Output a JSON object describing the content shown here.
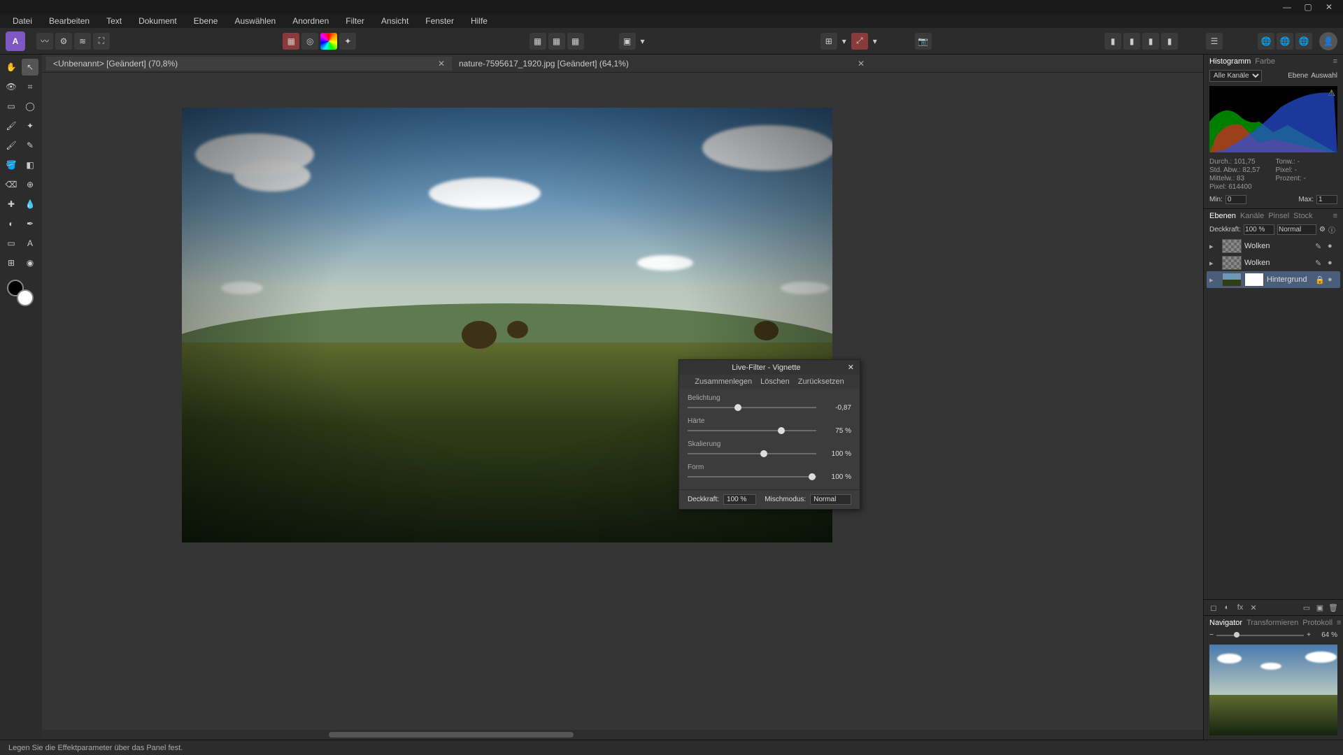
{
  "menu": [
    "Datei",
    "Bearbeiten",
    "Text",
    "Dokument",
    "Ebene",
    "Auswählen",
    "Anordnen",
    "Filter",
    "Ansicht",
    "Fenster",
    "Hilfe"
  ],
  "tabs": [
    {
      "title": "<Unbenannt> [Geändert] (70,8%)",
      "active": true
    },
    {
      "title": "nature-7595617_1920.jpg [Geändert] (64,1%)",
      "active": false
    }
  ],
  "dialog": {
    "title": "Live-Filter - Vignette",
    "actions": [
      "Zusammenlegen",
      "Löschen",
      "Zurücksetzen"
    ],
    "sliders": [
      {
        "label": "Belichtung",
        "value": "-0,87",
        "pos": 39
      },
      {
        "label": "Härte",
        "value": "75 %",
        "pos": 73
      },
      {
        "label": "Skalierung",
        "value": "100 %",
        "pos": 59
      },
      {
        "label": "Form",
        "value": "100 %",
        "pos": 97
      }
    ],
    "opacity_label": "Deckkraft:",
    "opacity_value": "100 %",
    "blend_label": "Mischmodus:",
    "blend_value": "Normal"
  },
  "rightpanel": {
    "top_tabs": [
      "Histogramm",
      "Farbe"
    ],
    "channel_label": "Alle Kanäle",
    "channel_r1": "Ebene",
    "channel_r2": "Auswahl",
    "stats": {
      "durch": "Durch.: 101,75",
      "tonw": "Tonw.: -",
      "std": "Std. Abw.: 82,57",
      "pixelr": "Pixel: -",
      "mittel": "Mittelw.: 83",
      "prozent": "Prozent: -",
      "pixel": "Pixel: 614400"
    },
    "min_label": "Min:",
    "min_val": "0",
    "max_label": "Max:",
    "max_val": "1",
    "layer_tabs": [
      "Ebenen",
      "Kanäle",
      "Pinsel",
      "Stock"
    ],
    "layer_opacity_label": "Deckkraft:",
    "layer_opacity": "100 %",
    "layer_blend": "Normal",
    "layers": [
      {
        "name": "Wolken",
        "type": "pixel"
      },
      {
        "name": "Wolken",
        "type": "pixel"
      },
      {
        "name": "Hintergrund",
        "type": "bg",
        "sel": true
      }
    ],
    "nav_tabs": [
      "Navigator",
      "Transformieren",
      "Protokoll"
    ],
    "zoom_value": "64 %"
  },
  "status": "Legen Sie die Effektparameter über das Panel fest."
}
